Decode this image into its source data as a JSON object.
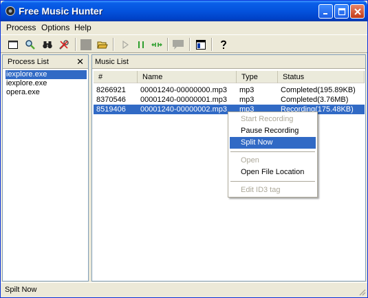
{
  "window": {
    "title": "Free Music Hunter"
  },
  "menu": [
    "Process",
    "Options",
    "Help"
  ],
  "toolbar_icons": [
    "new-icon",
    "find-icon",
    "binoculars-icon",
    "tools-icon",
    "stop-icon",
    "open-folder-icon",
    "play-icon",
    "pause-icon",
    "split-icon",
    "comment-icon",
    "window-icon",
    "help-icon"
  ],
  "process_list": {
    "title": "Process List",
    "items": [
      "iexplore.exe",
      "iexplore.exe",
      "opera.exe"
    ],
    "selected_index": 0
  },
  "music_list": {
    "title": "Music List",
    "columns": [
      "#",
      "Name",
      "Type",
      "Status"
    ],
    "rows": [
      {
        "id": "8266921",
        "name": "00001240-00000000.mp3",
        "type": "mp3",
        "status": "Completed(195.89KB)"
      },
      {
        "id": "8370546",
        "name": "00001240-00000001.mp3",
        "type": "mp3",
        "status": "Completed(3.76MB)"
      },
      {
        "id": "8519406",
        "name": "00001240-00000002.mp3",
        "type": "mp3",
        "status": "Recording(175.48KB)"
      }
    ],
    "selected_index": 2
  },
  "context_menu": {
    "items": [
      {
        "label": "Start Recording",
        "enabled": false
      },
      {
        "label": "Pause Recording",
        "enabled": true
      },
      {
        "label": "Split Now",
        "enabled": true,
        "highlighted": true
      },
      {
        "label": "Open",
        "enabled": false
      },
      {
        "label": "Open File Location",
        "enabled": true
      },
      {
        "label": "Edit ID3 tag",
        "enabled": false
      }
    ]
  },
  "status_bar": {
    "text": "Spilt Now"
  },
  "colors": {
    "titlebar": "#0453dd",
    "selection": "#316ac5",
    "window_bg": "#ece9d8"
  }
}
